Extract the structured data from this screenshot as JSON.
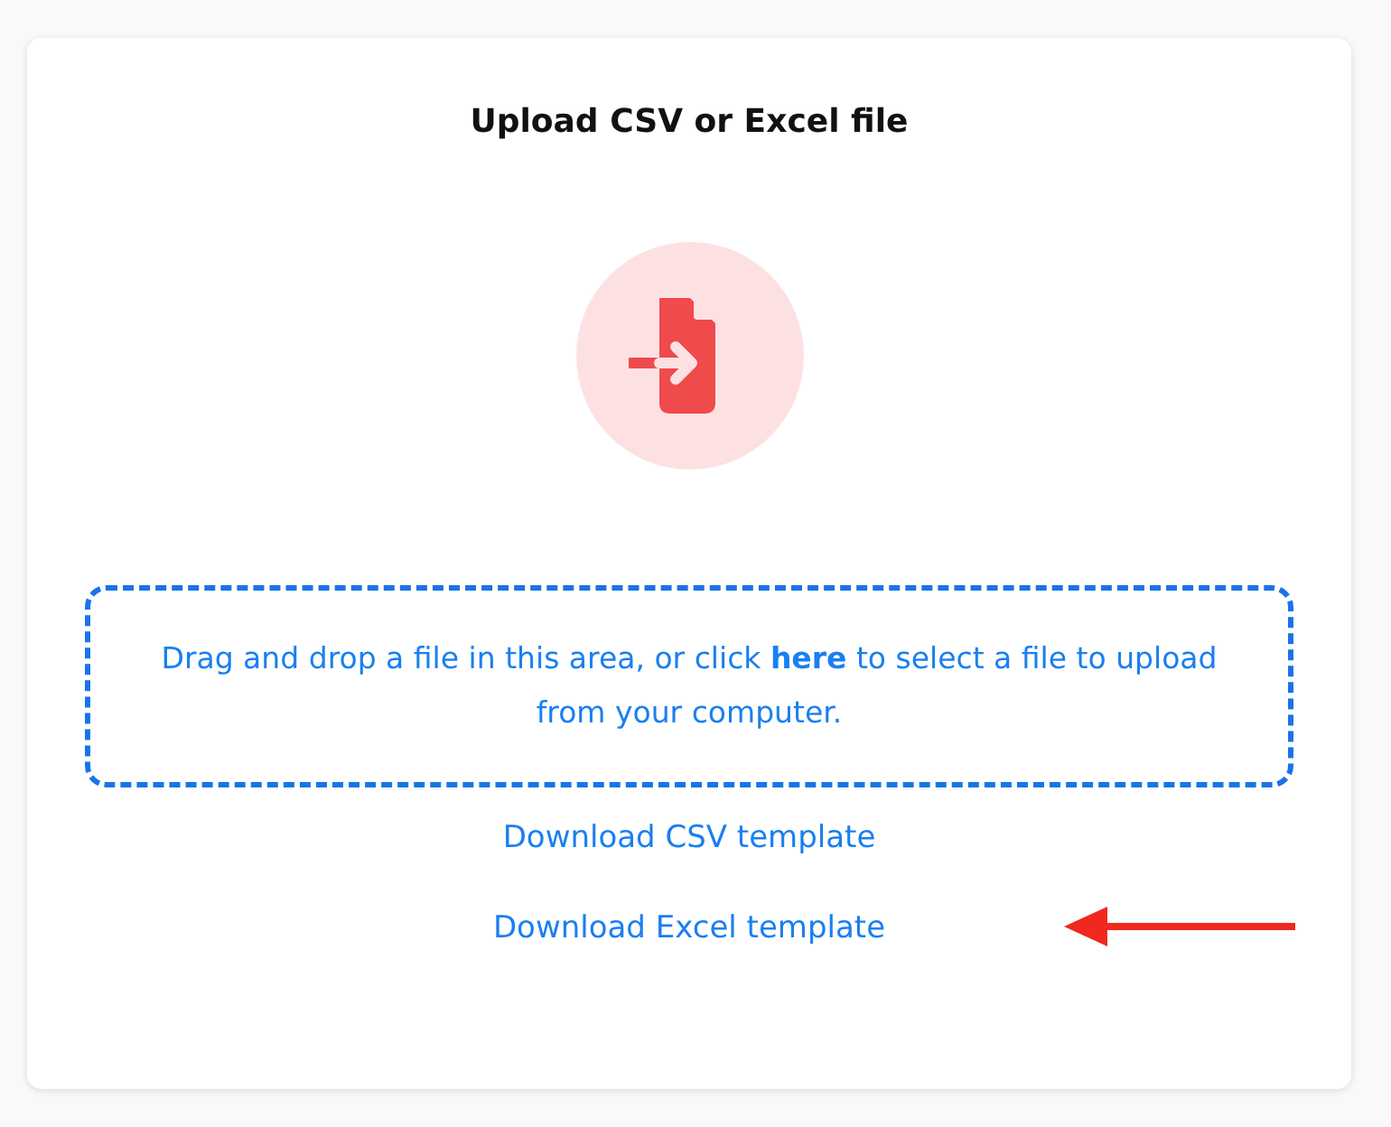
{
  "title": "Upload CSV or Excel file",
  "dropzone": {
    "text": "Drag and drop a file in this area, or click **here** to select a file to upload from your computer."
  },
  "links": [
    "Download CSV template",
    "Download Excel template"
  ]
}
